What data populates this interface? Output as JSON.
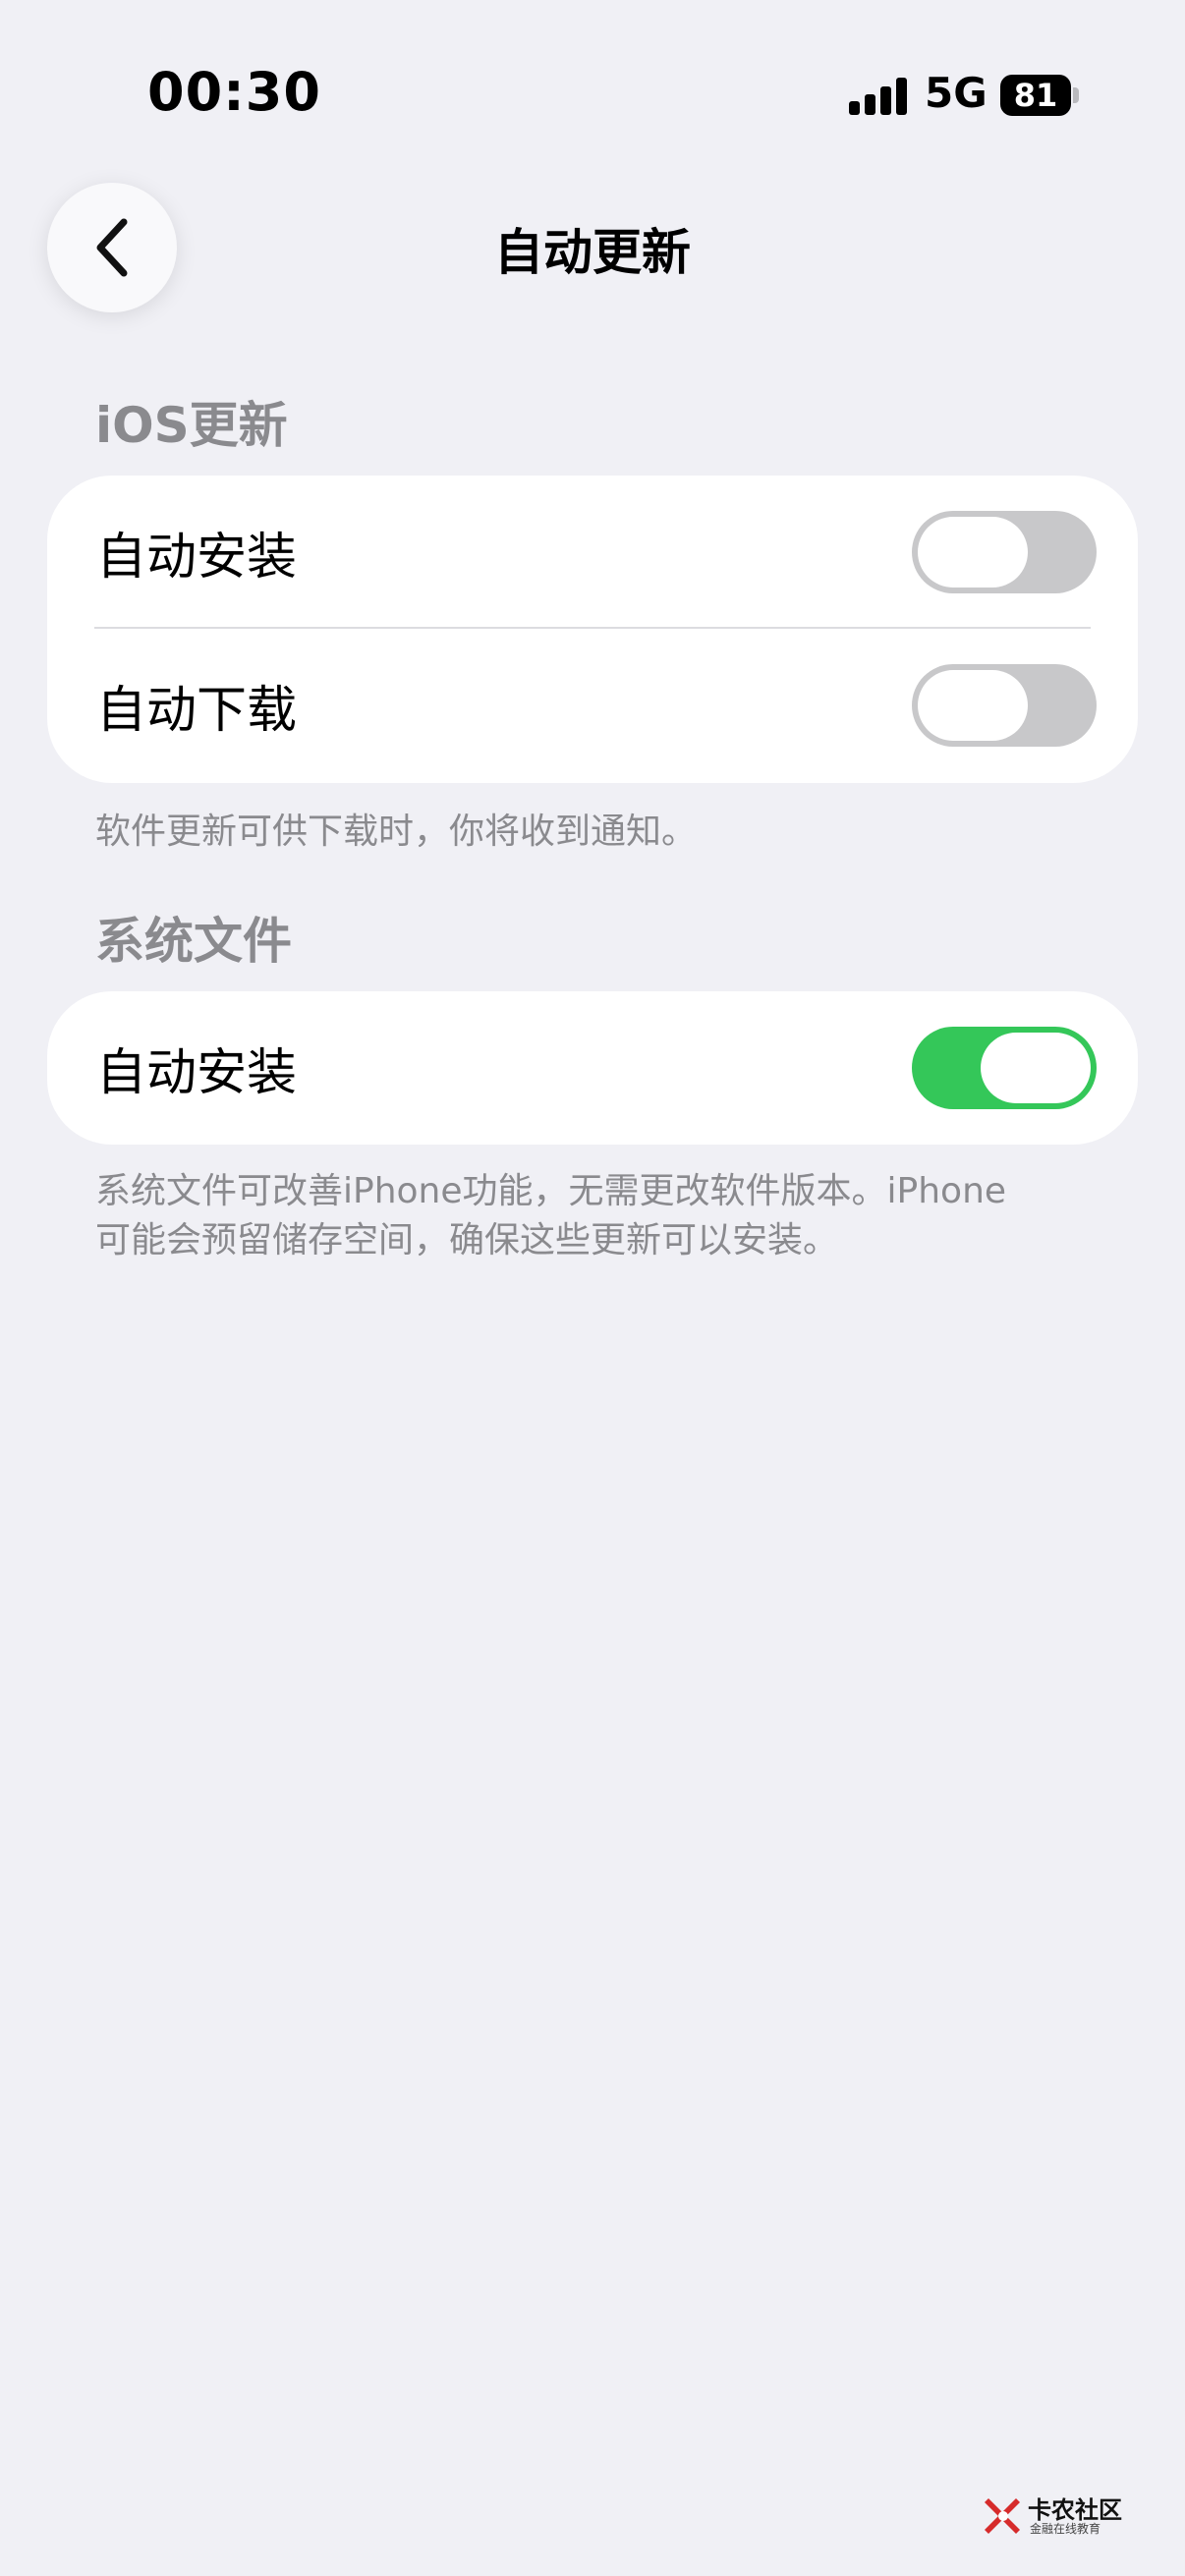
{
  "status_bar": {
    "time": "00:30",
    "network": "5G",
    "battery": "81"
  },
  "nav": {
    "title": "自动更新",
    "back_icon": "chevron-left-icon"
  },
  "sections": [
    {
      "header": "iOS更新",
      "rows": [
        {
          "label": "自动安装",
          "toggle": false
        },
        {
          "label": "自动下载",
          "toggle": false
        }
      ],
      "footnote": "软件更新可供下载时，你将收到通知。"
    },
    {
      "header": "系统文件",
      "rows": [
        {
          "label": "自动安装",
          "toggle": true
        }
      ],
      "footnote_line1": "系统文件可改善iPhone功能，无需更改软件版本。iPhone",
      "footnote_line2": "可能会预留储存空间，确保这些更新可以安装。"
    }
  ],
  "colors": {
    "background": "#f0f0f5",
    "toggle_on": "#34c759",
    "toggle_off": "#c8c8ca",
    "secondary_text": "#8a8a8e"
  },
  "watermark": {
    "title": "卡农社区",
    "subtitle": "金融在线教育"
  }
}
